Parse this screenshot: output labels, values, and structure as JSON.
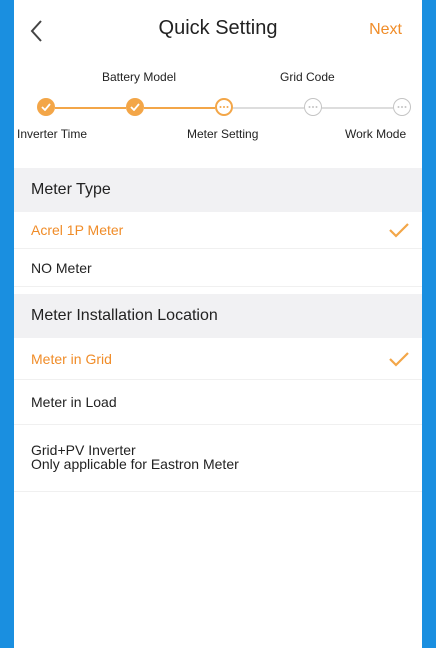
{
  "header": {
    "title": "Quick Setting",
    "next_label": "Next"
  },
  "stepper": {
    "top_labels": [
      "Battery Model",
      "Grid Code"
    ],
    "bottom_labels": [
      "Inverter Time",
      "Meter Setting",
      "Work Mode"
    ],
    "steps": [
      {
        "status": "done"
      },
      {
        "status": "done"
      },
      {
        "status": "current"
      },
      {
        "status": "pending"
      },
      {
        "status": "pending"
      }
    ]
  },
  "meter_type": {
    "title": "Meter Type",
    "options": [
      {
        "label": "Acrel 1P Meter",
        "selected": true
      },
      {
        "label": "NO Meter",
        "selected": false
      }
    ]
  },
  "meter_location": {
    "title": "Meter Installation Location",
    "options": [
      {
        "label": "Meter in Grid",
        "selected": true
      },
      {
        "label": "Meter in Load",
        "selected": false
      },
      {
        "label": "Grid+PV Inverter",
        "sub": "Only applicable for Eastron Meter",
        "selected": false
      }
    ]
  },
  "colors": {
    "accent": "#f08c28",
    "step_done": "#f3a648",
    "step_pending": "#c4c4c4",
    "section_bg": "#f1f1f3",
    "frame": "#1a8fe0"
  },
  "icons": {
    "back": "chevron-left-icon",
    "check": "checkmark-icon",
    "step_done": "check-circle-icon",
    "step_pending": "ellipsis-circle-icon"
  }
}
